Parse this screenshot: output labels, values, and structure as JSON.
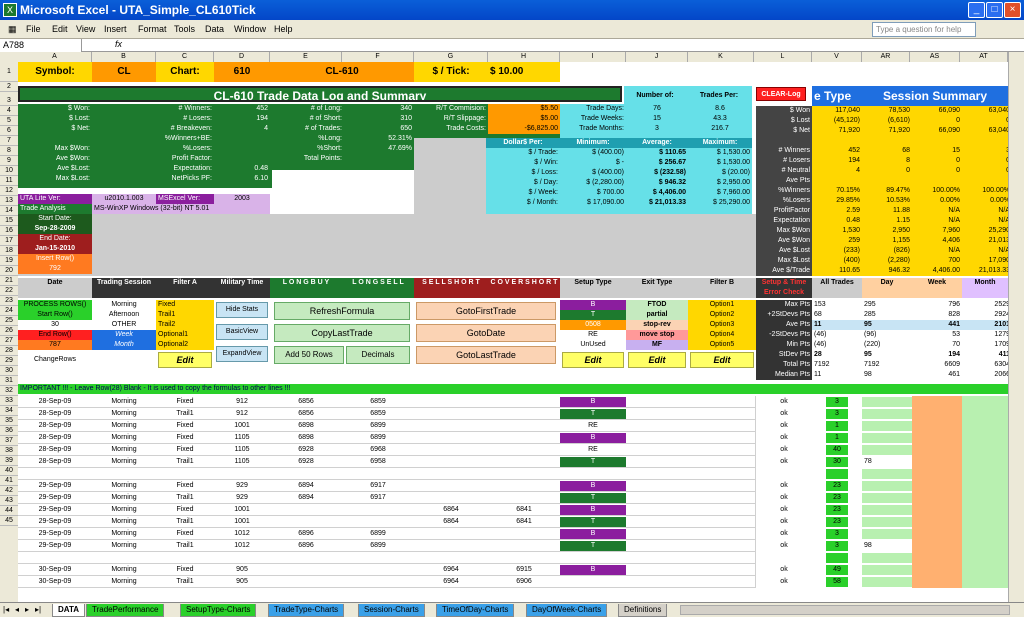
{
  "window": {
    "title": "Microsoft Excel - UTA_Simple_CL610Tick",
    "icon": "X",
    "min": "_",
    "max": "□",
    "close": "×"
  },
  "menu": [
    "File",
    "Edit",
    "View",
    "Insert",
    "Format",
    "Tools",
    "Data",
    "Window",
    "Help"
  ],
  "ask": "Type a question for help",
  "namebox": "A788",
  "fx": "fx",
  "columns": [
    "A",
    "B",
    "C",
    "D",
    "E",
    "F",
    "G",
    "H",
    "I",
    "J",
    "K",
    "L",
    "V",
    "AR",
    "AS",
    "AT"
  ],
  "rows": [
    "1",
    "2",
    "3",
    "4",
    "5",
    "6",
    "7",
    "8",
    "9",
    "10",
    "11",
    "12",
    "13",
    "14",
    "15",
    "16",
    "17",
    "18",
    "19",
    "20",
    "21",
    "22",
    "23",
    "24",
    "25",
    "26",
    "27",
    "28",
    "29",
    "30",
    "31",
    "32",
    "33",
    "34",
    "35",
    "36",
    "37",
    "38",
    "39",
    "40",
    "41",
    "42",
    "43",
    "44",
    "45"
  ],
  "header": {
    "symbol_label": "Symbol:",
    "symbol": "CL",
    "chart_label": "Chart:",
    "chart": "610",
    "chart_name": "CL-610",
    "tick_label": "$ / Tick:",
    "tick_value": "$       10.00"
  },
  "title": "CL-610 Trade Data Log and Summary",
  "number_of": "Number of:",
  "trades_per": "Trades Per:",
  "clear_log": "CLEAR-Log",
  "session_summary": "Session Summary",
  "type_partial": "e  Type",
  "left_stats": [
    "$ Won:",
    "$ Lost:",
    "$ Net:",
    "",
    "Max $Won:",
    "Ave $Won:",
    "Ave $Lost:",
    "Max $Lost:"
  ],
  "winners": [
    "# Winners:",
    "452",
    "# Losers:",
    "194",
    "# Breakeven:",
    "4",
    "%Winners+BE:",
    "",
    "%Losers:",
    "",
    "Profit Factor:",
    "",
    "Expectation:",
    "0.48",
    "NetPicks PF:",
    "6.10"
  ],
  "longs": [
    "# of Long:",
    "340",
    "# of Short:",
    "310",
    "# of Trades:",
    "650",
    "%Long:",
    "52.31%",
    "%Short:",
    "47.69%",
    "Total Points:",
    ""
  ],
  "rt": [
    "R/T Commision:",
    "$5.50",
    "R/T Slippage:",
    "$5.00",
    "Trade Costs:",
    "-$6,825.00"
  ],
  "tradedays": [
    "Trade Days:",
    "76",
    "8.6",
    "Trade Weeks:",
    "15",
    "43.3",
    "Trade Months:",
    "3",
    "216.7"
  ],
  "dollars": [
    "Dollar$ Per:",
    "Minimum:",
    "Average:",
    "Maximum:"
  ],
  "dollar_rows": [
    [
      "$ / Trade:",
      "$      (400.00)",
      "$      110.65",
      "$     1,530.00"
    ],
    [
      "$ / Win:",
      "$            -",
      "$      256.67",
      "$     1,530.00"
    ],
    [
      "$ / Loss:",
      "$      (400.00)",
      "$      (232.58)",
      "$        (20.00)"
    ],
    [
      "$ / Day:",
      "$   (2,280.00)",
      "$      946.32",
      "$     2,950.00"
    ],
    [
      "$ / Week:",
      "$      700.00",
      "$   4,406.00",
      "$     7,960.00"
    ],
    [
      "$ / Month:",
      "$  17,090.00",
      "$ 21,013.33",
      "$   25,290.00"
    ]
  ],
  "version": [
    "UTA Lite Ver:",
    "u2010.1.003",
    "MSExcel Ver:",
    "2003",
    "Trade Analysis",
    "MS-WinXP   Windows (32-bit) NT 5.01"
  ],
  "dates": [
    "Start Date:",
    "Sep-28-2009",
    "End Date:",
    "Jan-15-2010",
    "Insert Row()",
    "792"
  ],
  "summary_labels": [
    "$ Won",
    "$ Lost",
    "$ Net",
    "",
    "# Winners",
    "# Losers",
    "# Neutral",
    "Ave Pts",
    "%Winners",
    "%Losers",
    "ProfitFactor",
    "Expectation",
    "Max $Won",
    "Ave $Won",
    "Ave $Lost",
    "Max $Lost",
    "Ave $/Trade"
  ],
  "summary": [
    [
      "117,040",
      "78,530",
      "66,090",
      "63,040"
    ],
    [
      "(45,120)",
      "(6,610)",
      "0",
      "0"
    ],
    [
      "71,920",
      "71,920",
      "66,090",
      "63,040"
    ],
    [
      "",
      "",
      "",
      ""
    ],
    [
      "452",
      "68",
      "15",
      "3"
    ],
    [
      "194",
      "8",
      "0",
      "0"
    ],
    [
      "4",
      "0",
      "0",
      "0"
    ],
    [
      "",
      "",
      "",
      ""
    ],
    [
      "70.15%",
      "89.47%",
      "100.00%",
      "100.00%"
    ],
    [
      "29.85%",
      "10.53%",
      "0.00%",
      "0.00%"
    ],
    [
      "2.59",
      "11.88",
      "N/A",
      "N/A"
    ],
    [
      "0.48",
      "1.15",
      "N/A",
      "N/A"
    ],
    [
      "1,530",
      "2,950",
      "7,960",
      "25,290"
    ],
    [
      "259",
      "1,155",
      "4,406",
      "21,013"
    ],
    [
      "(233)",
      "(826)",
      "N/A",
      "N/A"
    ],
    [
      "(400)",
      "(2,280)",
      "700",
      "17,090"
    ],
    [
      "110.65",
      "946.32",
      "4,406.00",
      "21,013.33"
    ]
  ],
  "table_heads": [
    "Date",
    "Trading Session",
    "Filter A",
    "Military Time",
    "L O N G   B U Y",
    "L O N G   S E L L",
    "S E L L   S H O R T",
    "C O V E R   S H O R T",
    "Setup Type",
    "Exit Type",
    "Filter B",
    "Setup & Time Error Check",
    "All Trades",
    "Day",
    "Week",
    "Month"
  ],
  "ctrl": [
    "PROCESS ROWS()",
    "Start Row()",
    "30",
    "End Row()",
    "787",
    "ChangeRows"
  ],
  "sessions": [
    "Morning",
    "Afternoon",
    "OTHER",
    "Week",
    "Month"
  ],
  "filters": [
    "Fixed",
    "Trail1",
    "Trail2",
    "Optional1",
    "Optional2"
  ],
  "buttons": [
    "Hide Stats",
    "BasicView",
    "ExpandView",
    "RefreshFormula",
    "CopyLastTrade",
    "Add 50 Rows",
    "Decimals",
    "GotoFirstTrade",
    "GotoDate",
    "GotoLastTrade",
    "Edit"
  ],
  "setups": [
    "B",
    "T",
    "0508",
    "RE",
    "UnUsed"
  ],
  "exits": [
    "FTOD",
    "partial",
    "stop-rev",
    "move stop",
    "MF"
  ],
  "filterb": [
    "Option1",
    "Option2",
    "Option3",
    "Option4",
    "Option5"
  ],
  "stats_labels": [
    "Max Pts",
    "+2StDevs Pts",
    "Ave Pts",
    "-2StDevs Pts",
    "Min Pts",
    "StDev Pts",
    "Total Pts",
    "Median Pts"
  ],
  "stats": [
    [
      "153",
      "295",
      "796",
      "2529"
    ],
    [
      "68",
      "285",
      "828",
      "2924"
    ],
    [
      "11",
      "95",
      "441",
      "2101"
    ],
    [
      "(46)",
      "(96)",
      "53",
      "1279"
    ],
    [
      "(46)",
      "(220)",
      "70",
      "1709"
    ],
    [
      "28",
      "95",
      "194",
      "411"
    ],
    [
      "7192",
      "7192",
      "6609",
      "6304"
    ],
    [
      "11",
      "98",
      "461",
      "2066"
    ]
  ],
  "warn": "IMPORTANT !!! - Leave Row(28) Blank - It is used to copy the formulas to other lines !!!",
  "trades": [
    [
      "28-Sep-09",
      "Morning",
      "Fixed",
      "912",
      "6856",
      "6859",
      "",
      "",
      "B",
      "ok",
      "3",
      ""
    ],
    [
      "28-Sep-09",
      "Morning",
      "Trail1",
      "912",
      "6856",
      "6859",
      "",
      "",
      "T",
      "ok",
      "3",
      ""
    ],
    [
      "28-Sep-09",
      "Morning",
      "Fixed",
      "1001",
      "6898",
      "6899",
      "",
      "",
      "RE",
      "ok",
      "1",
      ""
    ],
    [
      "28-Sep-09",
      "Morning",
      "Fixed",
      "1105",
      "6898",
      "6899",
      "",
      "",
      "B",
      "ok",
      "1",
      ""
    ],
    [
      "28-Sep-09",
      "Morning",
      "Fixed",
      "1105",
      "6928",
      "6968",
      "",
      "",
      "RE",
      "ok",
      "40",
      ""
    ],
    [
      "28-Sep-09",
      "Morning",
      "Trail1",
      "1105",
      "6928",
      "6958",
      "",
      "",
      "T",
      "ok",
      "30",
      "78"
    ],
    [
      "",
      "",
      "",
      "",
      "",
      "",
      "",
      "",
      "",
      "",
      "",
      ""
    ],
    [
      "29-Sep-09",
      "Morning",
      "Fixed",
      "929",
      "6894",
      "6917",
      "",
      "",
      "B",
      "ok",
      "23",
      ""
    ],
    [
      "29-Sep-09",
      "Morning",
      "Trail1",
      "929",
      "6894",
      "6917",
      "",
      "",
      "T",
      "ok",
      "23",
      ""
    ],
    [
      "29-Sep-09",
      "Morning",
      "Fixed",
      "1001",
      "",
      "",
      "6864",
      "6841",
      "B",
      "ok",
      "23",
      ""
    ],
    [
      "29-Sep-09",
      "Morning",
      "Trail1",
      "1001",
      "",
      "",
      "6864",
      "6841",
      "T",
      "ok",
      "23",
      ""
    ],
    [
      "29-Sep-09",
      "Morning",
      "Fixed",
      "1012",
      "6896",
      "6899",
      "",
      "",
      "B",
      "ok",
      "3",
      ""
    ],
    [
      "29-Sep-09",
      "Morning",
      "Trail1",
      "1012",
      "6896",
      "6899",
      "",
      "",
      "T",
      "ok",
      "3",
      "98"
    ],
    [
      "",
      "",
      "",
      "",
      "",
      "",
      "",
      "",
      "",
      "",
      "",
      ""
    ],
    [
      "30-Sep-09",
      "Morning",
      "Fixed",
      "905",
      "",
      "",
      "6964",
      "6915",
      "B",
      "ok",
      "49",
      ""
    ],
    [
      "30-Sep-09",
      "Morning",
      "Trail1",
      "905",
      "",
      "",
      "6964",
      "6906",
      "",
      "ok",
      "58",
      ""
    ]
  ],
  "tabs": [
    "DATA",
    "TradePerformance",
    "SetupType-Charts",
    "TradeType-Charts",
    "Session-Charts",
    "TimeOfDay-Charts",
    "DayOfWeek-Charts",
    "Definitions"
  ],
  "colors": {
    "green": "#1d7a2e",
    "yellow": "#ffd700",
    "orange": "#ff9900",
    "blue": "#1f6fe0",
    "dark": "#333333",
    "cyan": "#66e0e8",
    "purple": "#8b1e9e"
  }
}
